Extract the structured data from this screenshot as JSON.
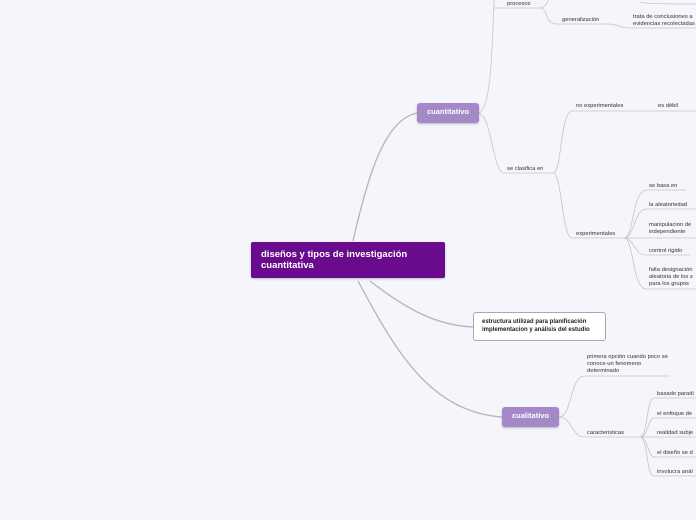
{
  "root": {
    "label": "diseños y tipos de investigación cuantitativa"
  },
  "cuantitativo": {
    "label": "cuantitativo",
    "procesos": "procesos",
    "generalizacion": "generalización",
    "generalizacion_detail": "trata de conclusiones a evidencias recolectadas",
    "clasifica": "se clasifica en",
    "no_experimentales": "no experimentales",
    "es_debil": "es débil",
    "experimentales": "experimentales",
    "exp_items": [
      "se basa en",
      "la aleatoriedad",
      "manipulacion de independiente",
      "control rigido",
      "falta designación aleatoria de los s para los grupos"
    ]
  },
  "estructura": {
    "label": "estructura utilizad para planificación implementacion y análisis del estudio"
  },
  "cualitativo": {
    "label": "cualitativo",
    "primera": "primera opción cuando poco se conoce un fenomeno determinado",
    "caracteristicas": "caracteristicas",
    "car_items": [
      "basado paradi",
      "el enfoque de",
      "realidad subje",
      "el diseño se d",
      "involucra anál"
    ]
  },
  "colors": {
    "root_bg": "#6a0a8c",
    "main_bg": "#a488c8",
    "line": "#b8b8be",
    "background": "#f4f6fc"
  }
}
